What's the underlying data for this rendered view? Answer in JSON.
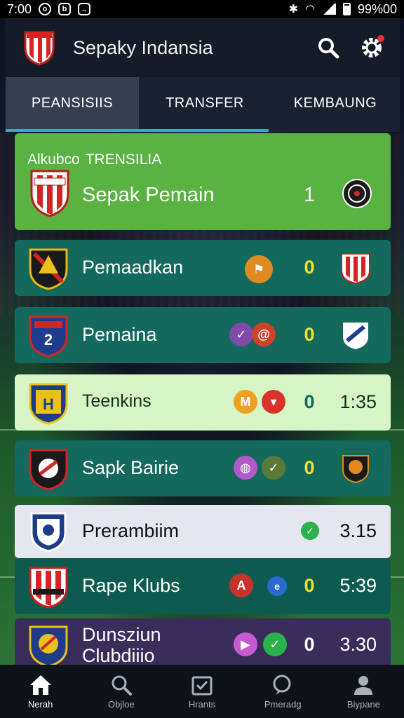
{
  "status_bar": {
    "time": "7:00",
    "battery": "99%00"
  },
  "header": {
    "title": "Sepaky Indansia"
  },
  "tabs": [
    {
      "label": "PEANSISIIS",
      "active": true
    },
    {
      "label": "TRANSFER",
      "active": false
    },
    {
      "label": "KEMBAUNG",
      "active": false
    }
  ],
  "featured": {
    "label_a": "Alkubco",
    "label_b": "TRENSILIA",
    "name": "Sepak Pemain",
    "rank": "1"
  },
  "rows": [
    {
      "name": "Pemaadkan",
      "score": "0",
      "time": ""
    },
    {
      "name": "Pemaina",
      "score": "0",
      "time": ""
    },
    {
      "name": "Teenkins",
      "mini_a": "M",
      "score": "0",
      "time": "1:35"
    },
    {
      "name": "Sapk Bairie",
      "score": "0",
      "time": ""
    },
    {
      "name": "Prerambiim",
      "time": "3.15"
    },
    {
      "name": "Rape Klubs",
      "score": "0",
      "time": "5:39"
    },
    {
      "name_line1": "Dunsziun",
      "name_line2": "Clubdiiio",
      "score": "0",
      "time": "3.30"
    }
  ],
  "bottom_nav": [
    {
      "label": "Nerah",
      "icon": "home-icon",
      "active": true
    },
    {
      "label": "Objloe",
      "icon": "search-icon",
      "active": false
    },
    {
      "label": "Hrants",
      "icon": "checklist-icon",
      "active": false
    },
    {
      "label": "Pmeradg",
      "icon": "chat-search-icon",
      "active": false
    },
    {
      "label": "Biypane",
      "icon": "profile-icon",
      "active": false
    }
  ],
  "colors": {
    "featured": "#5ab243",
    "teal": "#12695c",
    "light_green": "#d7f5c4",
    "score_yellow": "#f3df2a",
    "tab_indicator": "#34a8d8"
  }
}
